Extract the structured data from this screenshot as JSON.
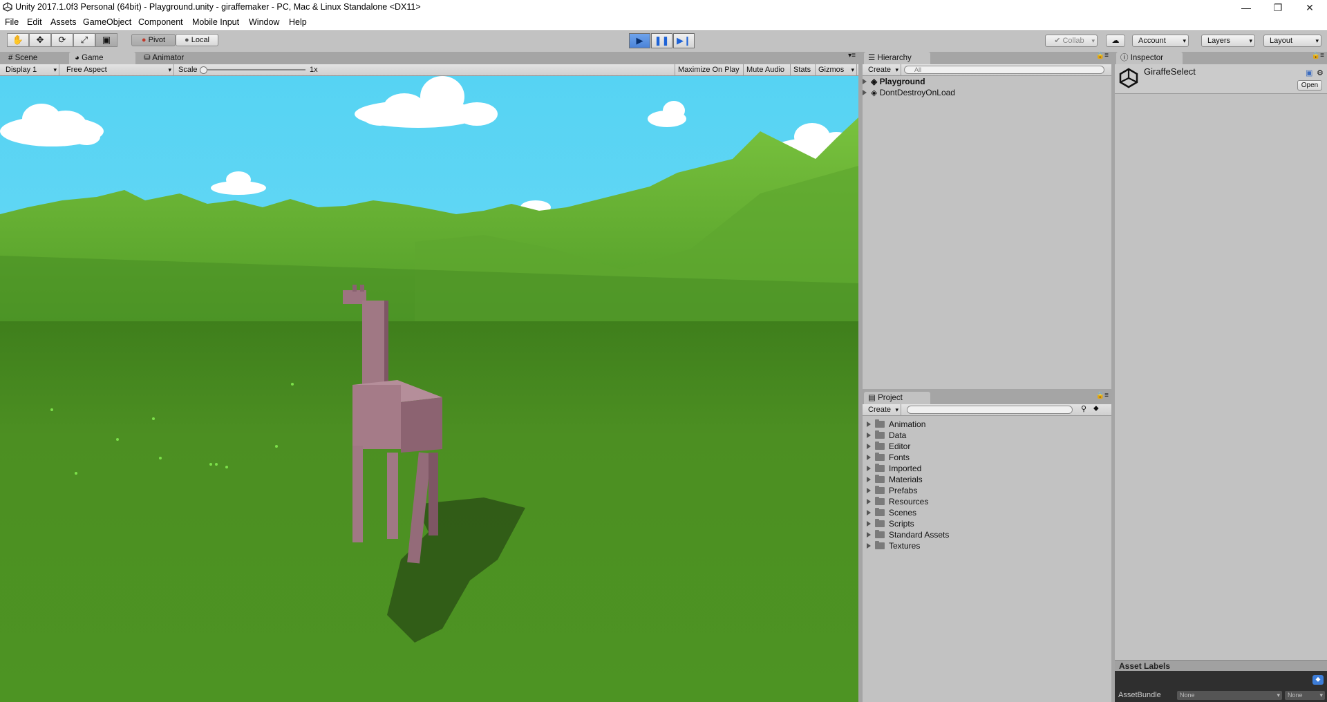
{
  "window": {
    "title": "Unity 2017.1.0f3 Personal (64bit) - Playground.unity - giraffemaker - PC, Mac & Linux Standalone <DX11>",
    "controls": [
      "—",
      "❐",
      "✕"
    ]
  },
  "menubar": [
    "File",
    "Edit",
    "Assets",
    "GameObject",
    "Component",
    "Mobile Input",
    "Window",
    "Help"
  ],
  "toolbar": {
    "pivot_label": "Pivot",
    "local_label": "Local",
    "collab_label": "Collab",
    "account_label": "Account",
    "layers_label": "Layers",
    "layout_label": "Layout"
  },
  "scene_tabs": [
    "Scene",
    "Game",
    "Animator"
  ],
  "game_toolbar": {
    "display": "Display 1",
    "aspect": "Free Aspect",
    "scale_label": "Scale",
    "scale_value": "1x",
    "maximize": "Maximize On Play",
    "mute": "Mute Audio",
    "stats": "Stats",
    "gizmos": "Gizmos"
  },
  "hierarchy": {
    "tab": "Hierarchy",
    "create": "Create",
    "search_placeholder": "All",
    "items": [
      "Playground",
      "DontDestroyOnLoad"
    ]
  },
  "project": {
    "tab": "Project",
    "create": "Create",
    "folders": [
      "Animation",
      "Data",
      "Editor",
      "Fonts",
      "Imported",
      "Materials",
      "Prefabs",
      "Resources",
      "Scenes",
      "Scripts",
      "Standard Assets",
      "Textures"
    ]
  },
  "inspector": {
    "tab": "Inspector",
    "object_name": "GiraffeSelect",
    "open_button": "Open",
    "asset_labels": "Asset Labels",
    "asset_bundle_label": "AssetBundle",
    "bundle_value": "None",
    "variant_value": "None"
  },
  "colors": {
    "sky": "#5ad4f2",
    "grass": "#4f9125",
    "mountain": "#6fb83a",
    "giraffe": "#a57b88",
    "play_active": "#5b93e2"
  }
}
